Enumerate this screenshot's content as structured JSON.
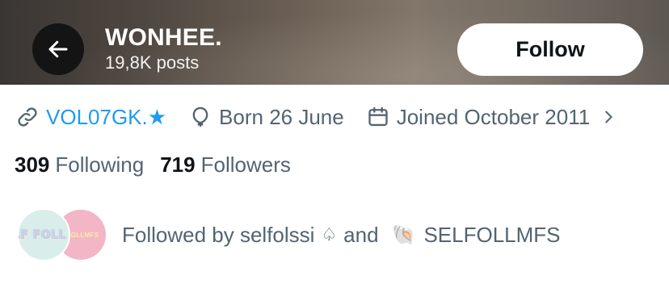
{
  "header": {
    "back_icon": "arrow-left-icon",
    "name": "WONHEE.",
    "posts": "19,8K posts",
    "follow_label": "Follow"
  },
  "meta": {
    "link_icon": "link-icon",
    "link_text": "VOL07GK.★",
    "birthday_icon": "balloon-icon",
    "birthday_text": "Born 26 June",
    "joined_icon": "calendar-icon",
    "joined_text": "Joined October 2011",
    "more_icon": "chevron-right-icon"
  },
  "stats": {
    "following_count": "309",
    "following_label": "Following",
    "followers_count": "719",
    "followers_label": "Followers"
  },
  "followed_by": {
    "prefix": "Followed by selfolssi",
    "spade": "♤",
    "and": "and",
    "shell": "🐚",
    "second_name": "SELFOLLMFS",
    "avatar1_text": "SELF FOLL SSI",
    "avatar2_text": "OLLMFS"
  },
  "colors": {
    "link": "#1d9bf0",
    "secondary_text": "#536471",
    "primary_text": "#0f1419"
  }
}
